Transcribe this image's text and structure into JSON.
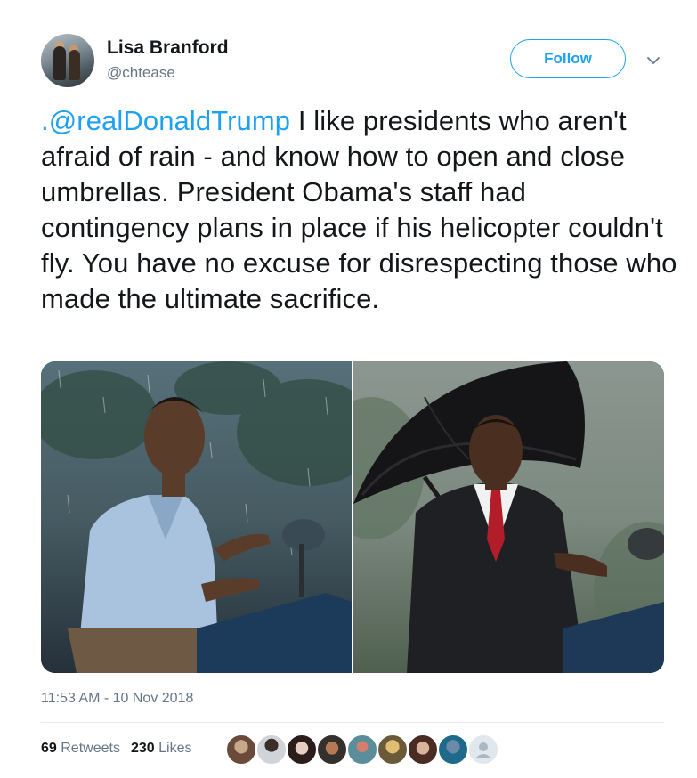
{
  "user": {
    "name": "Lisa Branford",
    "handle": "@chtease"
  },
  "actions": {
    "follow_label": "Follow"
  },
  "tweet": {
    "mention": ".@realDonaldTrump",
    "body": " I like presidents who aren't afraid of rain - and know how to open and close umbrellas. President Obama's staff had contingency plans in place if his helicopter couldn't fly. You have no excuse for disrespecting those who made the ultimate sacrifice."
  },
  "timestamp": "11:53 AM - 10 Nov 2018",
  "stats": {
    "retweets_count": "69",
    "retweets_label": "Retweets",
    "likes_count": "230",
    "likes_label": "Likes"
  },
  "colors": {
    "accent": "#1da1f2",
    "secondary_text": "#657786",
    "primary_text": "#14171a"
  },
  "likers": [
    {
      "icon": "liker-avatar-1"
    },
    {
      "icon": "liker-avatar-2"
    },
    {
      "icon": "liker-avatar-3"
    },
    {
      "icon": "liker-avatar-4"
    },
    {
      "icon": "liker-avatar-5"
    },
    {
      "icon": "liker-avatar-6"
    },
    {
      "icon": "liker-avatar-7"
    },
    {
      "icon": "liker-avatar-8"
    },
    {
      "icon": "default-avatar-icon"
    }
  ]
}
